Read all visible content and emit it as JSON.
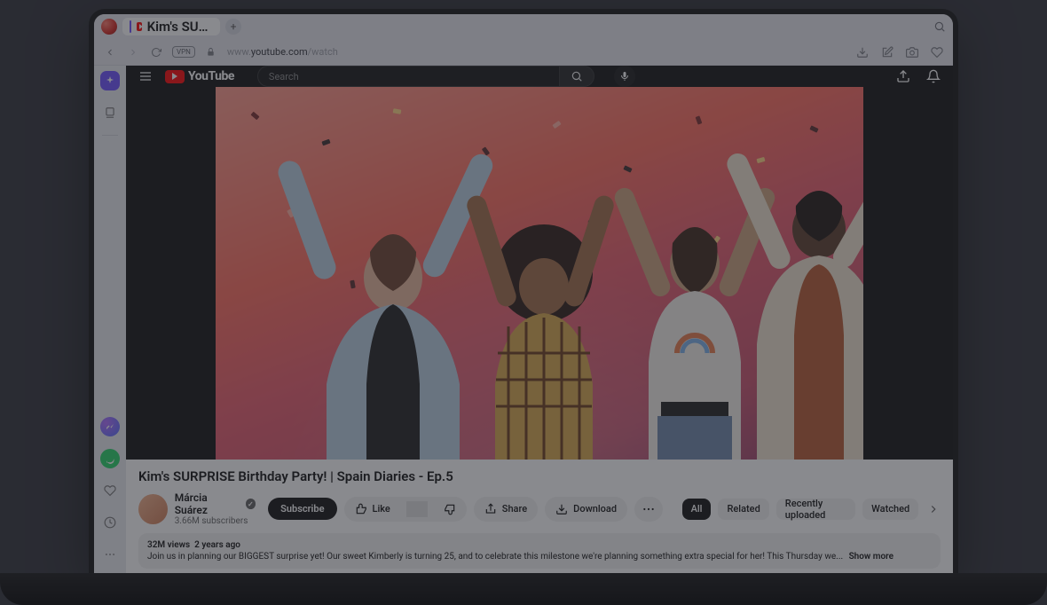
{
  "browser": {
    "tab_title": "Kim's SUPRISE Birt",
    "url_prefix": "www.",
    "url_domain": "youtube.com",
    "url_path": "/watch"
  },
  "masthead": {
    "logo_text": "YouTube",
    "search_placeholder": "Search"
  },
  "video": {
    "title": "Kim's SURPRISE Birthday Party! | Spain Diaries - Ep.5",
    "channel_name": "Márcia Suárez",
    "subscribers": "3.66M subscribers",
    "subscribe_label": "Subscribe",
    "like_label": "Like",
    "share_label": "Share",
    "download_label": "Download",
    "views": "32M views",
    "age": "2 years ago",
    "description_snippet": "Join us in planning our BIGGEST surprise yet! Our sweet Kimberly is turning 25, and to celebrate this milestone we're planning something extra special for her! This Thursday we...",
    "show_more": "Show more"
  },
  "chips": [
    "All",
    "Related",
    "Recently uploaded",
    "Watched"
  ]
}
